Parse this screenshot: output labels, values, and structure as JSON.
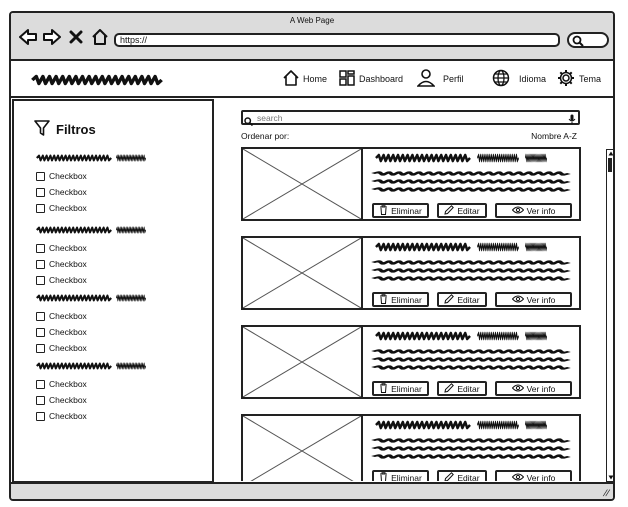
{
  "window": {
    "title": "A Web Page"
  },
  "browser": {
    "url": "https://"
  },
  "nav": {
    "home": "Home",
    "dashboard": "Dashboard",
    "profile": "Perfil",
    "language": "Idioma",
    "theme": "Tema"
  },
  "sidebar": {
    "title": "Filtros",
    "groups": [
      {
        "checkboxes": [
          "Checkbox",
          "Checkbox",
          "Checkbox"
        ]
      },
      {
        "checkboxes": [
          "Checkbox",
          "Checkbox",
          "Checkbox"
        ]
      },
      {
        "checkboxes": [
          "Checkbox",
          "Checkbox",
          "Checkbox"
        ]
      },
      {
        "checkboxes": [
          "Checkbox",
          "Checkbox",
          "Checkbox"
        ]
      }
    ]
  },
  "search": {
    "placeholder": "search"
  },
  "sort": {
    "label": "Ordenar por:",
    "value": "Nombre A-Z"
  },
  "cards": [
    {
      "delete": "Eliminar",
      "edit": "Editar",
      "view": "Ver info"
    },
    {
      "delete": "Eliminar",
      "edit": "Editar",
      "view": "Ver info"
    },
    {
      "delete": "Eliminar",
      "edit": "Editar",
      "view": "Ver info"
    },
    {
      "delete": "Eliminar",
      "edit": "Editar",
      "view": "Ver info"
    }
  ]
}
